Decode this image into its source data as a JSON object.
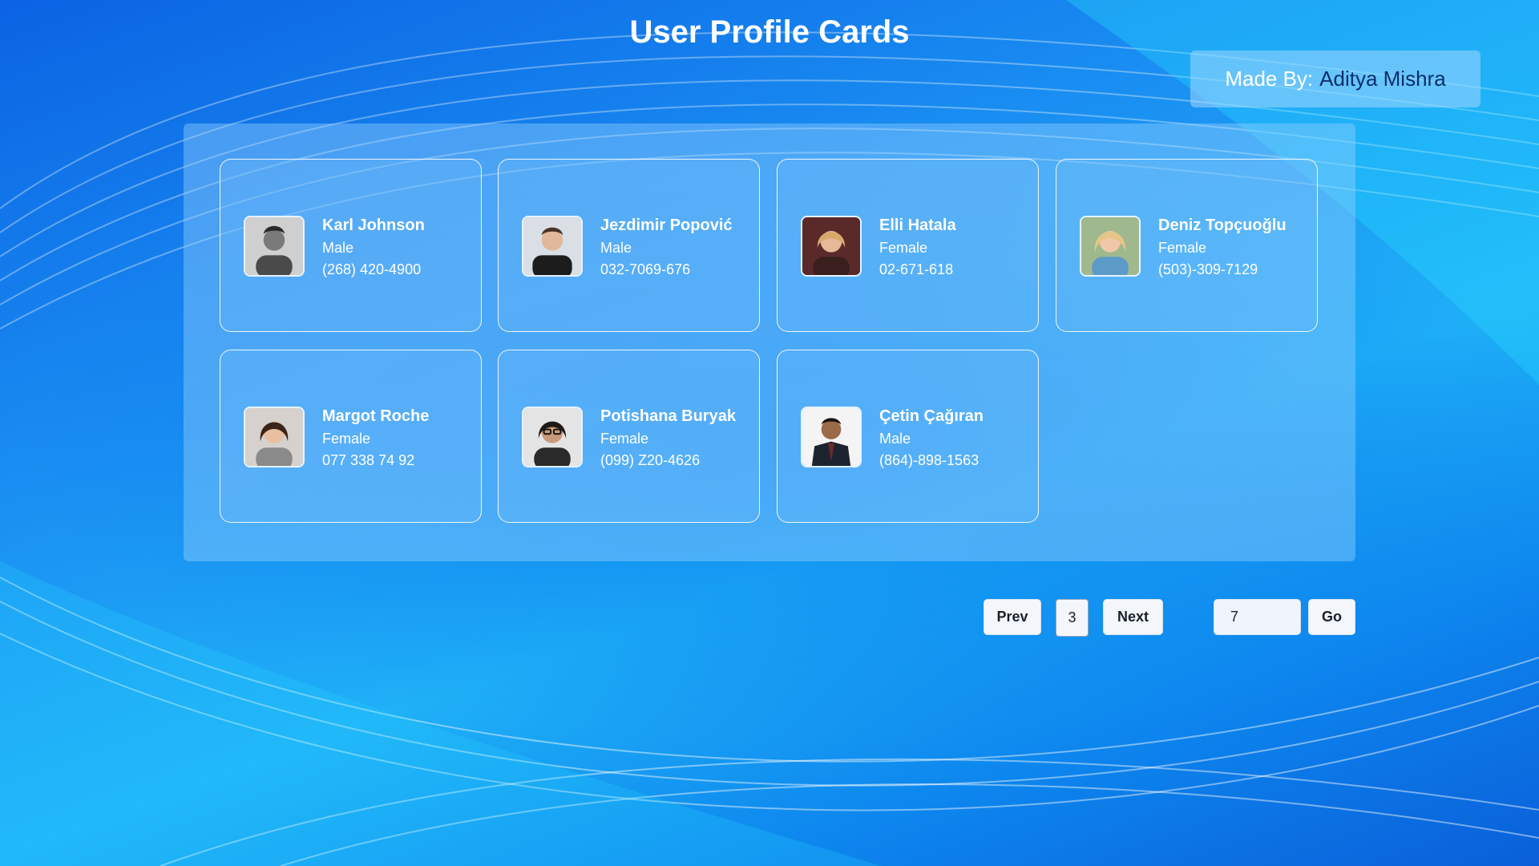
{
  "header": {
    "title": "User Profile Cards",
    "made_by_label": "Made By:",
    "made_by_name": "Aditya Mishra"
  },
  "cards": [
    {
      "name": "Karl Johnson",
      "gender": "Male",
      "phone": "(268) 420-4900"
    },
    {
      "name": "Jezdimir Popović",
      "gender": "Male",
      "phone": "032-7069-676"
    },
    {
      "name": "Elli Hatala",
      "gender": "Female",
      "phone": "02-671-618"
    },
    {
      "name": "Deniz Topçuoğlu",
      "gender": "Female",
      "phone": "(503)-309-7129"
    },
    {
      "name": "Margot Roche",
      "gender": "Female",
      "phone": "077 338 74 92"
    },
    {
      "name": "Potishana Buryak",
      "gender": "Female",
      "phone": "(099) Z20-4626"
    },
    {
      "name": "Çetin Çağıran",
      "gender": "Male",
      "phone": "(864)-898-1563"
    }
  ],
  "pagination": {
    "prev_label": "Prev",
    "current_page": "3",
    "next_label": "Next",
    "goto_value": "7",
    "go_label": "Go"
  }
}
